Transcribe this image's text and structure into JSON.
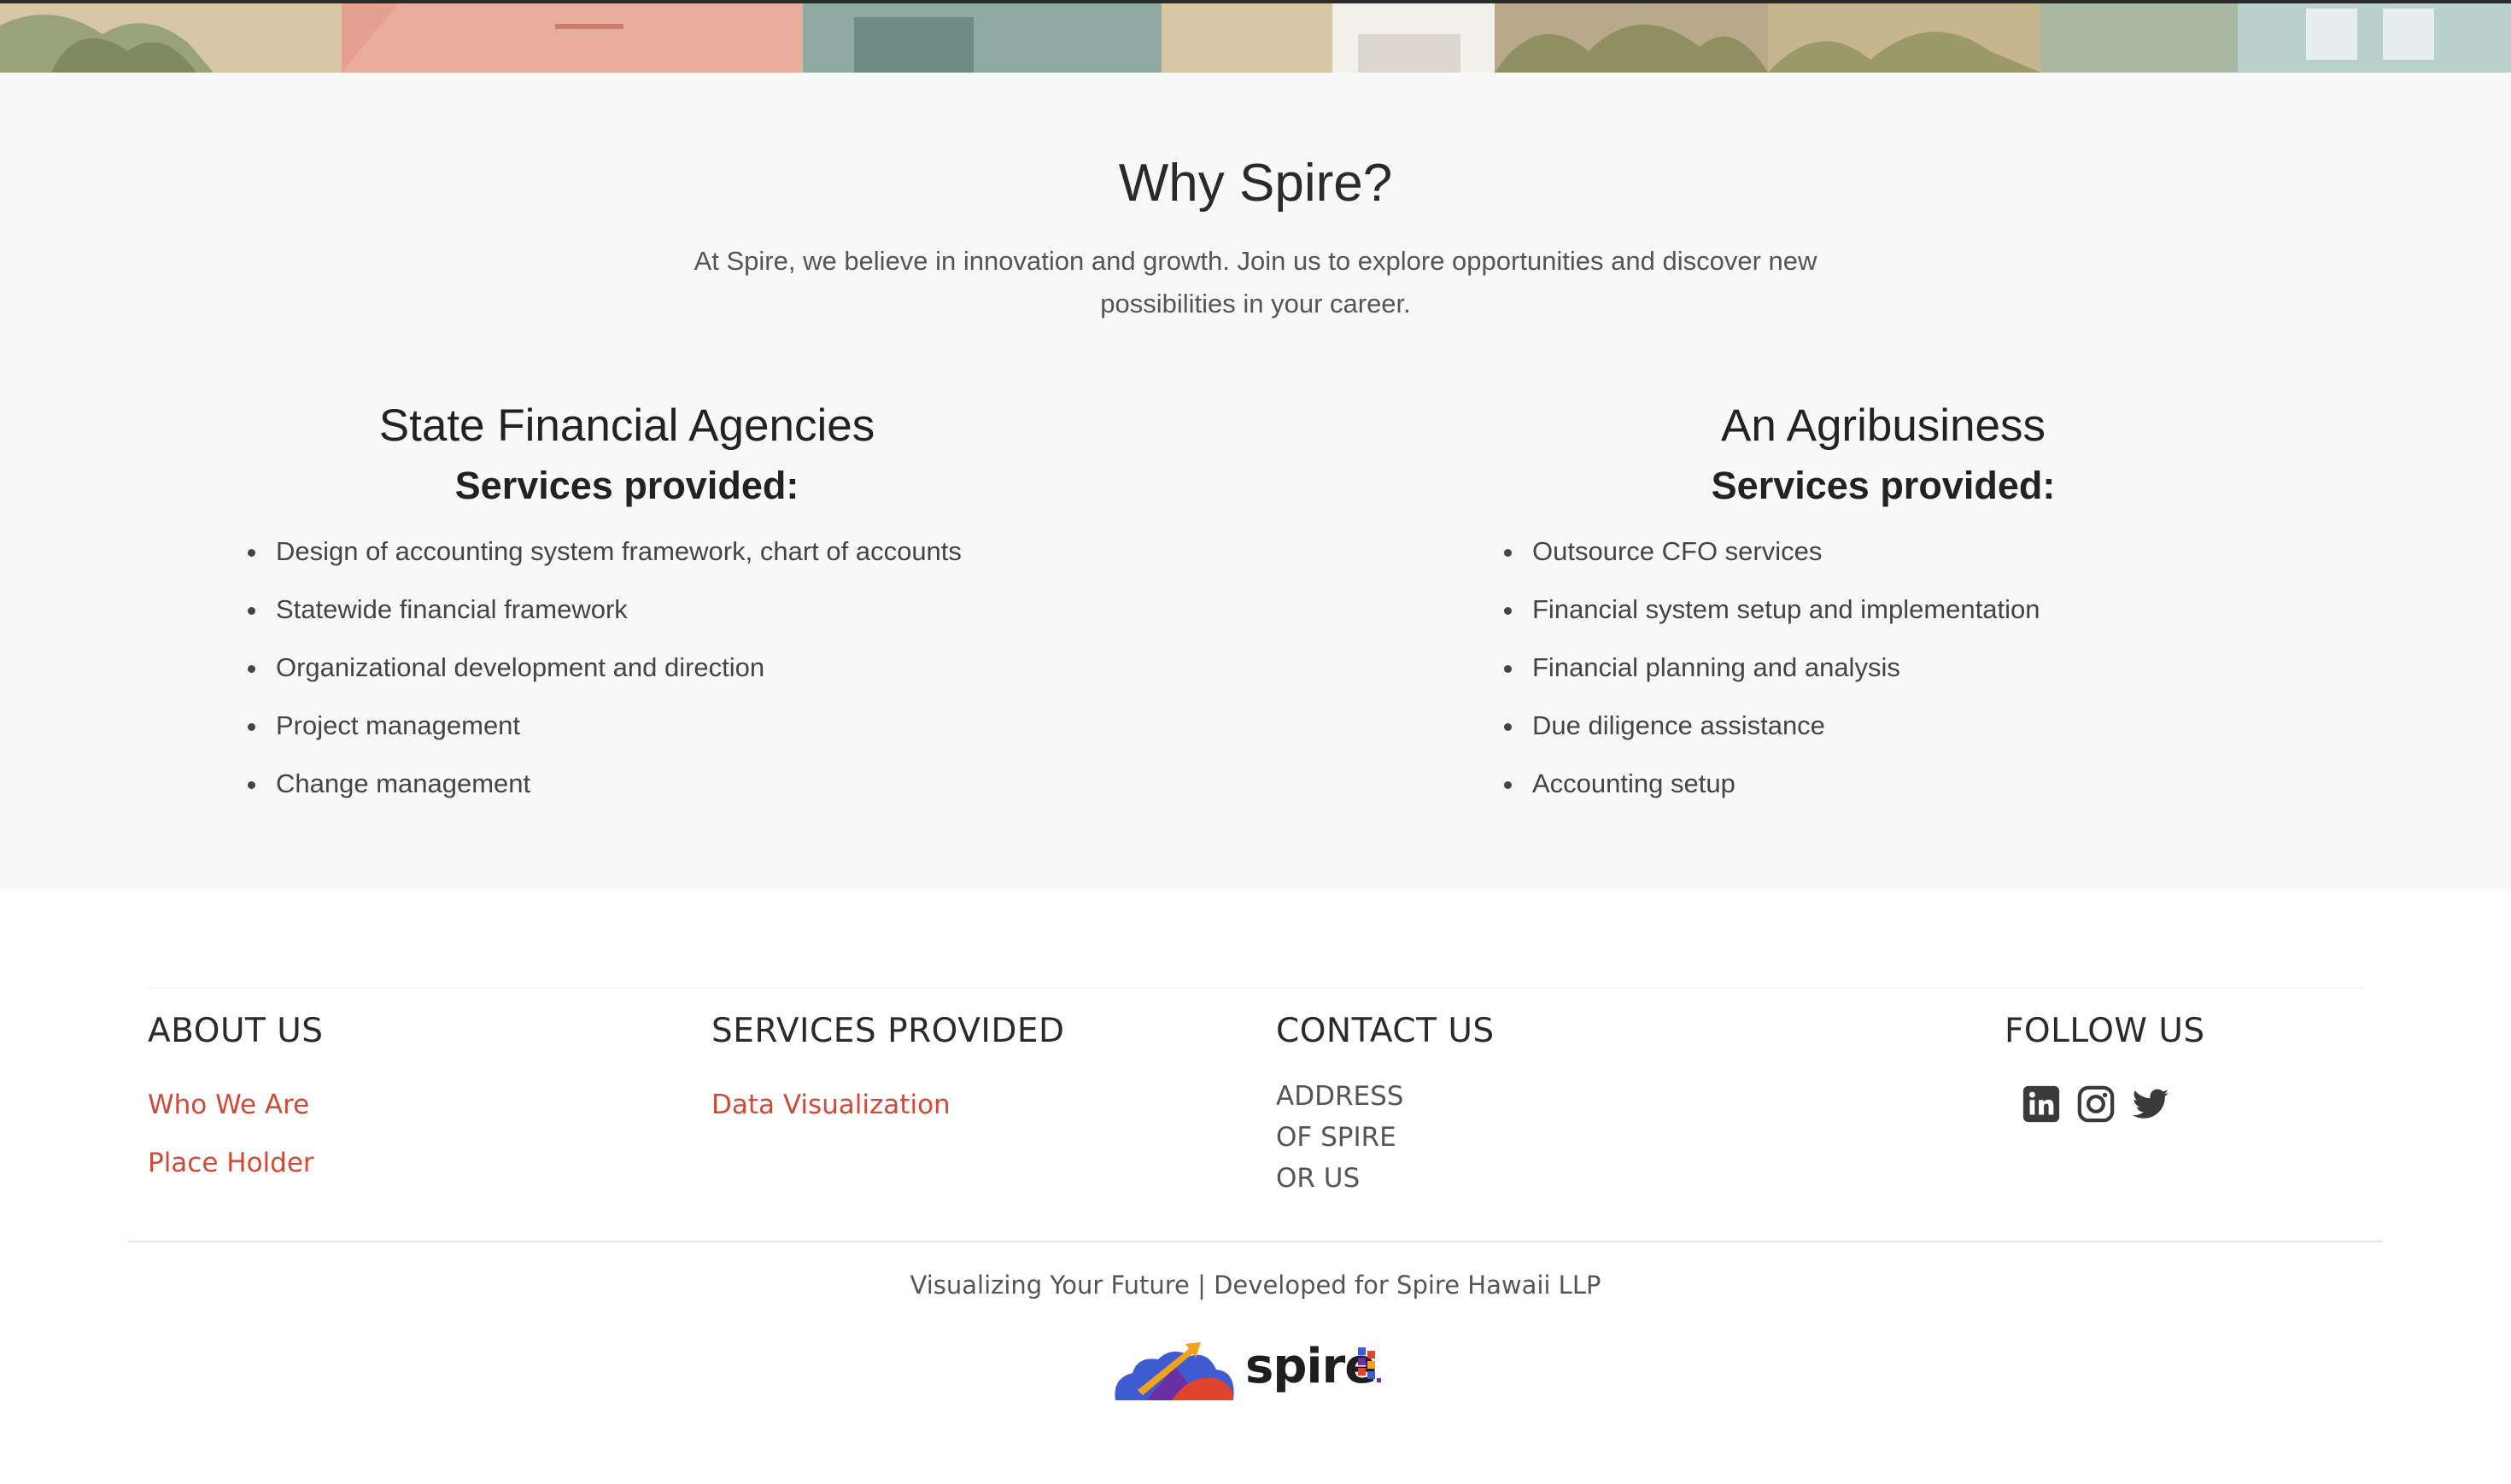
{
  "why": {
    "title": "Why Spire?",
    "subtitle": "At Spire, we believe in innovation and growth. Join us to explore opportunities and discover new possibilities in your career."
  },
  "clients": [
    {
      "name": "State Financial Agencies",
      "services_heading": "Services provided:",
      "services": [
        "Design of accounting system framework, chart of accounts",
        "Statewide financial framework",
        "Organizational development and direction",
        "Project management",
        "Change management"
      ]
    },
    {
      "name": "An Agribusiness",
      "services_heading": "Services provided:",
      "services": [
        "Outsource CFO services",
        "Financial system setup and implementation",
        "Financial planning and analysis",
        "Due diligence assistance",
        "Accounting setup"
      ]
    }
  ],
  "footer": {
    "about": {
      "heading": "ABOUT US",
      "links": [
        "Who We Are",
        "Place Holder"
      ]
    },
    "services": {
      "heading": "SERVICES PROVIDED",
      "links": [
        "Data Visualization"
      ]
    },
    "contact": {
      "heading": "CONTACT US",
      "address_lines": [
        "ADDRESS",
        "OF SPIRE",
        "OR US"
      ]
    },
    "follow": {
      "heading": "FOLLOW US",
      "icons": [
        "linkedin-icon",
        "instagram-icon",
        "twitter-icon"
      ]
    },
    "tagline": "Visualizing Your Future | Developed for Spire Hawaii LLP",
    "logo_text": "spire"
  },
  "colors": {
    "link": "#d04a36",
    "section_bg": "#f8f8f8",
    "icon": "#3a3a3a"
  }
}
